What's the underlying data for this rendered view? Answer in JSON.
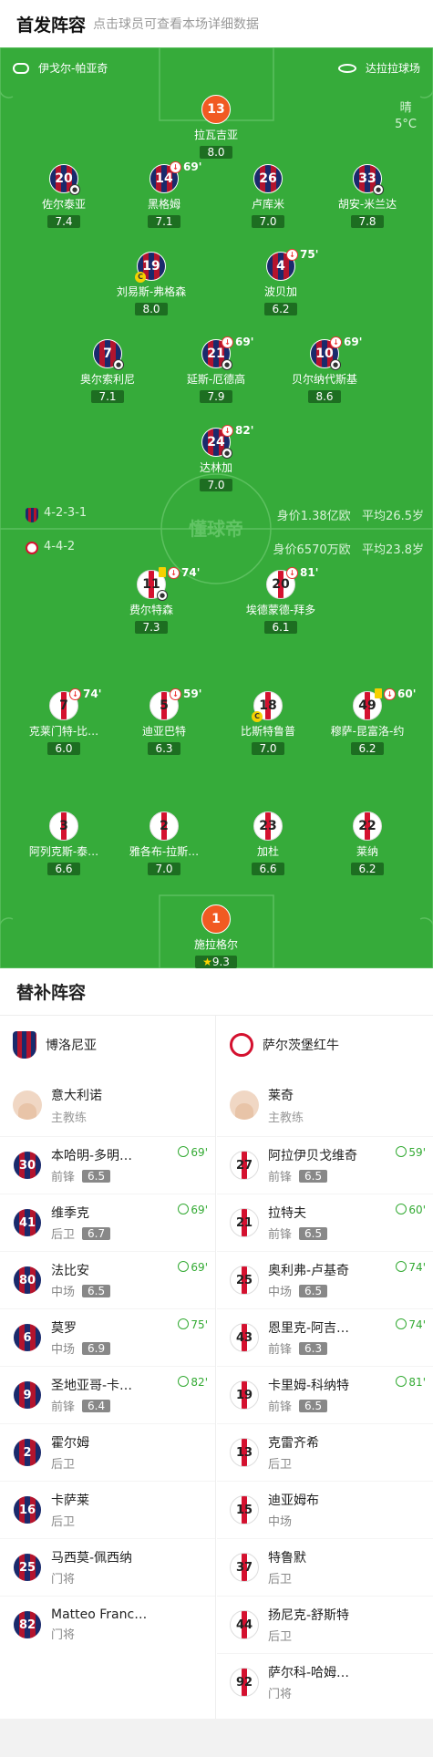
{
  "header": {
    "title": "首发阵容",
    "subtitle": "点击球员可查看本场详细数据"
  },
  "pitch": {
    "home_coach_label": "伊戈尔-帕亚奇",
    "venue": "达拉拉球场",
    "weather": "晴",
    "temp": "5°C",
    "watermark": "懂球帝"
  },
  "home": {
    "formation": "4-2-3-1",
    "value": "身价1.38亿欧",
    "age": "平均26.5岁",
    "color": "#1a2a6c"
  },
  "away": {
    "formation": "4-4-2",
    "value": "身价6570万欧",
    "age": "平均23.8岁",
    "color": "#d4112f"
  },
  "home_players": [
    {
      "num": "13",
      "name": "拉瓦吉亚",
      "rating": "8.0"
    },
    {
      "num": "20",
      "name": "佐尔泰亚",
      "rating": "7.4"
    },
    {
      "num": "14",
      "name": "黑格姆",
      "rating": "7.1",
      "sub": "69'"
    },
    {
      "num": "26",
      "name": "卢库米",
      "rating": "7.0"
    },
    {
      "num": "33",
      "name": "胡安-米兰达",
      "rating": "7.8"
    },
    {
      "num": "19",
      "name": "刘易斯-弗格森",
      "rating": "8.0"
    },
    {
      "num": "4",
      "name": "波贝加",
      "rating": "6.2",
      "sub": "75'"
    },
    {
      "num": "7",
      "name": "奥尔索利尼",
      "rating": "7.1"
    },
    {
      "num": "21",
      "name": "延斯-厄德高",
      "rating": "7.9",
      "sub": "69'"
    },
    {
      "num": "10",
      "name": "贝尔纳代斯基",
      "rating": "8.6",
      "sub": "69'"
    },
    {
      "num": "24",
      "name": "达林加",
      "rating": "7.0",
      "sub": "82'"
    }
  ],
  "away_players": [
    {
      "num": "11",
      "name": "费尔特森",
      "rating": "7.3",
      "sub": "74'"
    },
    {
      "num": "20",
      "name": "埃德蒙德-拜多",
      "rating": "6.1",
      "sub": "81'"
    },
    {
      "num": "7",
      "name": "克莱门特-比…",
      "rating": "6.0",
      "sub": "74'"
    },
    {
      "num": "5",
      "name": "迪亚巴特",
      "rating": "6.3",
      "sub": "59'"
    },
    {
      "num": "18",
      "name": "比斯特鲁普",
      "rating": "7.0"
    },
    {
      "num": "49",
      "name": "穆萨-昆富洛-约",
      "rating": "6.2",
      "sub": "60'"
    },
    {
      "num": "3",
      "name": "阿列克斯-泰…",
      "rating": "6.6"
    },
    {
      "num": "2",
      "name": "雅各布-拉斯…",
      "rating": "7.0"
    },
    {
      "num": "23",
      "name": "加杜",
      "rating": "6.6"
    },
    {
      "num": "22",
      "name": "莱纳",
      "rating": "6.2"
    },
    {
      "num": "1",
      "name": "施拉格尔",
      "rating": "9.3"
    }
  ],
  "subs": {
    "title": "替补阵容",
    "home_team": "博洛尼亚",
    "away_team": "萨尔茨堡红牛",
    "home_coach": {
      "name": "意大利诺",
      "role": "主教练"
    },
    "away_coach": {
      "name": "莱奇",
      "role": "主教练"
    },
    "home": [
      {
        "num": "30",
        "name": "本哈明-多明…",
        "pos": "前锋",
        "rating": "6.5",
        "min": "69'"
      },
      {
        "num": "41",
        "name": "维季克",
        "pos": "后卫",
        "rating": "6.7",
        "min": "69'"
      },
      {
        "num": "80",
        "name": "法比安",
        "pos": "中场",
        "rating": "6.5",
        "min": "69'"
      },
      {
        "num": "6",
        "name": "莫罗",
        "pos": "中场",
        "rating": "6.9",
        "min": "75'"
      },
      {
        "num": "9",
        "name": "圣地亚哥-卡…",
        "pos": "前锋",
        "rating": "6.4",
        "min": "82'"
      },
      {
        "num": "2",
        "name": "霍尔姆",
        "pos": "后卫"
      },
      {
        "num": "16",
        "name": "卡萨莱",
        "pos": "后卫"
      },
      {
        "num": "25",
        "name": "马西莫-佩西纳",
        "pos": "门将"
      },
      {
        "num": "82",
        "name": "Matteo Franc…",
        "pos": "门将"
      }
    ],
    "away": [
      {
        "num": "27",
        "name": "阿拉伊贝戈维奇",
        "pos": "前锋",
        "rating": "6.5",
        "min": "59'"
      },
      {
        "num": "21",
        "name": "拉特夫",
        "pos": "前锋",
        "rating": "6.5",
        "min": "60'"
      },
      {
        "num": "25",
        "name": "奥利弗-卢基奇",
        "pos": "中场",
        "rating": "6.5",
        "min": "74'"
      },
      {
        "num": "43",
        "name": "恩里克-阿吉…",
        "pos": "前锋",
        "rating": "6.3",
        "min": "74'"
      },
      {
        "num": "19",
        "name": "卡里姆-科纳特",
        "pos": "前锋",
        "rating": "6.5",
        "min": "81'"
      },
      {
        "num": "13",
        "name": "克雷齐希",
        "pos": "后卫"
      },
      {
        "num": "15",
        "name": "迪亚姆布",
        "pos": "中场"
      },
      {
        "num": "37",
        "name": "特鲁默",
        "pos": "后卫"
      },
      {
        "num": "44",
        "name": "扬尼克-舒斯特",
        "pos": "后卫"
      },
      {
        "num": "92",
        "name": "萨尔科-哈姆…",
        "pos": "门将"
      }
    ]
  }
}
